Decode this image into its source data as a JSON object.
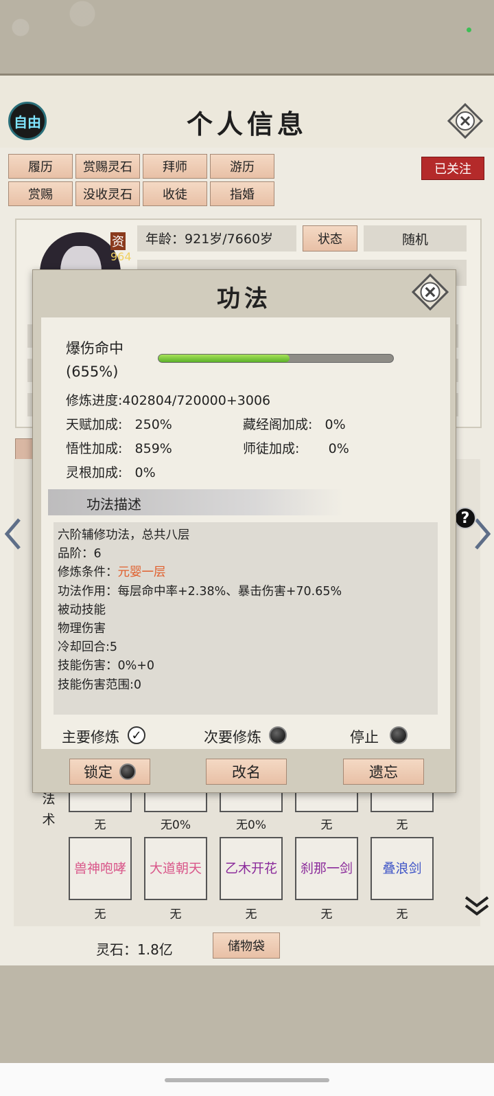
{
  "header": {
    "free_label": "自由",
    "title": "个人信息"
  },
  "tabs": {
    "row1": [
      "履历",
      "赏赐灵石",
      "拜师",
      "游历"
    ],
    "row2": [
      "赏赐",
      "没收灵石",
      "收徒",
      "指婚"
    ],
    "followed": "已关注"
  },
  "profile": {
    "zi_label": "资",
    "zi_value": "964",
    "age_label": "年龄：",
    "age_value": "921岁/7660岁",
    "state_button": "状态",
    "random_label": "随机"
  },
  "dialog": {
    "title": "功法",
    "skill_name_line1": "爆伤命中",
    "skill_name_line2": "(655%)",
    "progress_fraction": 0.559,
    "cultivation_progress": "修炼进度:402804/720000+3006",
    "talent_bonus": "天赋加成:   250%",
    "library_bonus": "藏经阁加成:   0%",
    "insight_bonus": "悟性加成:   859%",
    "master_bonus": "师徒加成:       0%",
    "root_bonus": "灵根加成:   0%",
    "desc_header": "功法描述",
    "desc_lines": [
      "六阶辅修功法，总共八层",
      "品阶：6",
      "修炼条件：",
      "功法作用：每层命中率+2.38%、暴击伤害+70.65%",
      "被动技能",
      "物理伤害",
      "冷却回合:5",
      "技能伤害：0%+0",
      "技能伤害范围:0"
    ],
    "requirement": "元婴一层",
    "main_practice": "主要修炼",
    "secondary_practice": "次要修炼",
    "stop": "停止",
    "lock": "锁定",
    "rename": "改名",
    "forget": "遗忘"
  },
  "skills": {
    "fashu_label": "法\n术",
    "row1_labels": [
      "无",
      "无0%",
      "无0%",
      "无",
      "无"
    ],
    "row2": [
      {
        "name": "兽神咆哮",
        "label": "无",
        "color": "#d9578a"
      },
      {
        "name": "大道朝天",
        "label": "无",
        "color": "#d9578a"
      },
      {
        "name": "乙木开花",
        "label": "无",
        "color": "#8b2c9b"
      },
      {
        "name": "刹那一剑",
        "label": "无",
        "color": "#8b2c9b"
      },
      {
        "name": "叠浪剑",
        "label": "无",
        "color": "#3f55c7"
      }
    ]
  },
  "footer": {
    "stone_label": "灵石：1.8亿",
    "bag_button": "储物袋"
  },
  "colors": {
    "accent_red": "#b42a2a",
    "button_peach": "#f0cdb5",
    "progress_green": "#6cc031"
  }
}
